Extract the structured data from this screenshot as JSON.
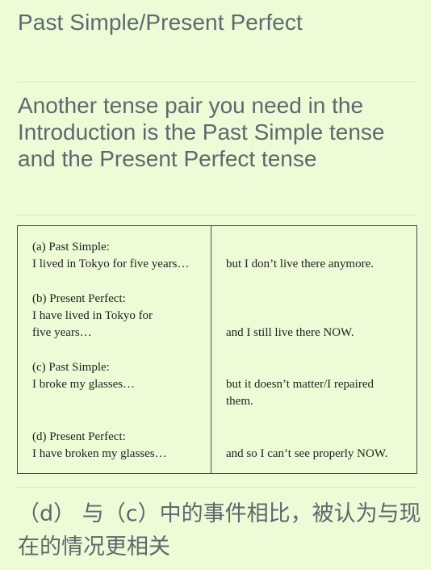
{
  "title": "Past Simple/Present Perfect",
  "heading": "Another tense pair you need in the Introduction is the Past Simple tense and the Present Perfect tense",
  "table": {
    "rows": [
      {
        "left_label": "(a) Past Simple:",
        "left_lines": [
          "I lived in Tokyo for five years…"
        ],
        "right_lines": [
          "but I don’t live there anymore."
        ]
      },
      {
        "left_label": "(b) Present Perfect:",
        "left_lines": [
          "I have lived in Tokyo for",
          "five years…"
        ],
        "right_lines": [
          "and I still live there NOW."
        ]
      },
      {
        "left_label": "(c) Past Simple:",
        "left_lines": [
          "I broke my glasses…"
        ],
        "right_lines": [
          "but it doesn’t matter/I repaired",
          "them."
        ]
      },
      {
        "left_label": "(d) Present Perfect:",
        "left_lines": [
          "I have broken my glasses…"
        ],
        "right_lines": [
          "and so I can’t see properly NOW."
        ]
      }
    ]
  },
  "note": "（d） 与（c）中的事件相比，被认为与现在的情况更相关"
}
